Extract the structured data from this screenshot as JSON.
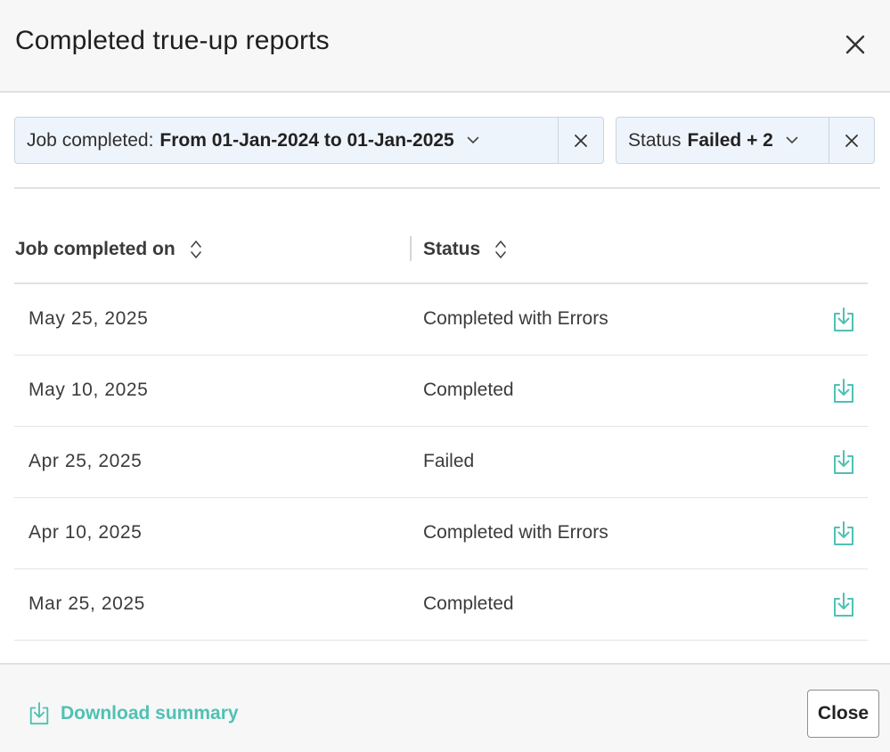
{
  "dialog": {
    "title": "Completed true-up reports"
  },
  "filters": {
    "job_completed": {
      "label": "Job completed:",
      "value": "From 01-Jan-2024 to 01-Jan-2025"
    },
    "status": {
      "label": "Status",
      "value": "Failed + 2"
    }
  },
  "table": {
    "columns": [
      "Job completed on",
      "Status"
    ],
    "rows": [
      {
        "date": "May 25, 2025",
        "status": "Completed with Errors"
      },
      {
        "date": "May 10, 2025",
        "status": "Completed"
      },
      {
        "date": "Apr 25, 2025",
        "status": "Failed"
      },
      {
        "date": "Apr 10, 2025",
        "status": "Completed with Errors"
      },
      {
        "date": "Mar 25, 2025",
        "status": "Completed"
      }
    ]
  },
  "footer": {
    "download_summary_label": "Download summary",
    "close_label": "Close"
  },
  "icons": {
    "close": "close-icon",
    "chevron": "chevron-down-icon",
    "sort": "sort-icon",
    "download": "download-icon"
  },
  "colors": {
    "accent": "#4fc1b4",
    "chip_background": "#eef4fb",
    "chip_border": "#c9d4de"
  }
}
